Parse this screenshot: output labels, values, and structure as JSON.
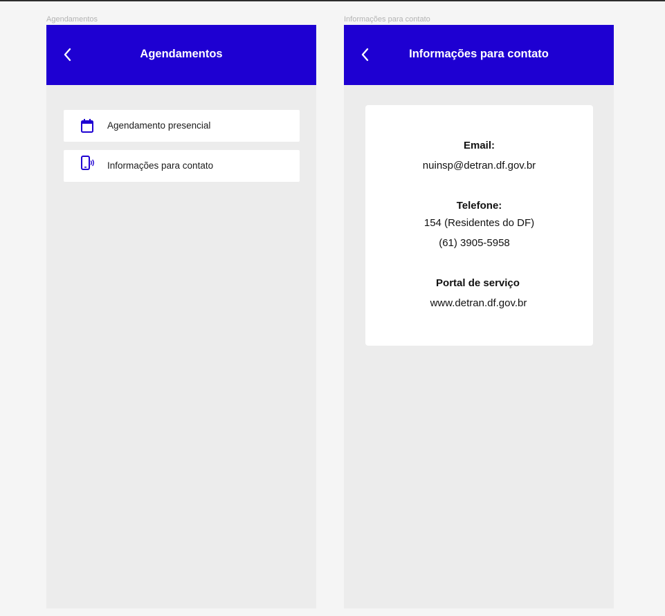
{
  "frames": {
    "left_label": "Agendamentos",
    "right_label": "Informações para contato"
  },
  "agendamentos": {
    "title": "Agendamentos",
    "items": [
      {
        "label": "Agendamento presencial",
        "icon": "calendar-icon"
      },
      {
        "label": "Informações para contato",
        "icon": "phone-vibrate-icon"
      }
    ]
  },
  "contato": {
    "title": "Informações para contato",
    "email_label": "Email:",
    "email_value": "nuinsp@detran.df.gov.br",
    "phone_label": "Telefone:",
    "phone_values": [
      "154 (Residentes do DF)",
      "(61) 3905-5958"
    ],
    "portal_label": "Portal de serviço",
    "portal_value": "www.detran.df.gov.br"
  },
  "colors": {
    "header": "#1e00d2",
    "background": "#ececec",
    "canvas": "#f5f5f5",
    "icon": "#1e00d2"
  }
}
